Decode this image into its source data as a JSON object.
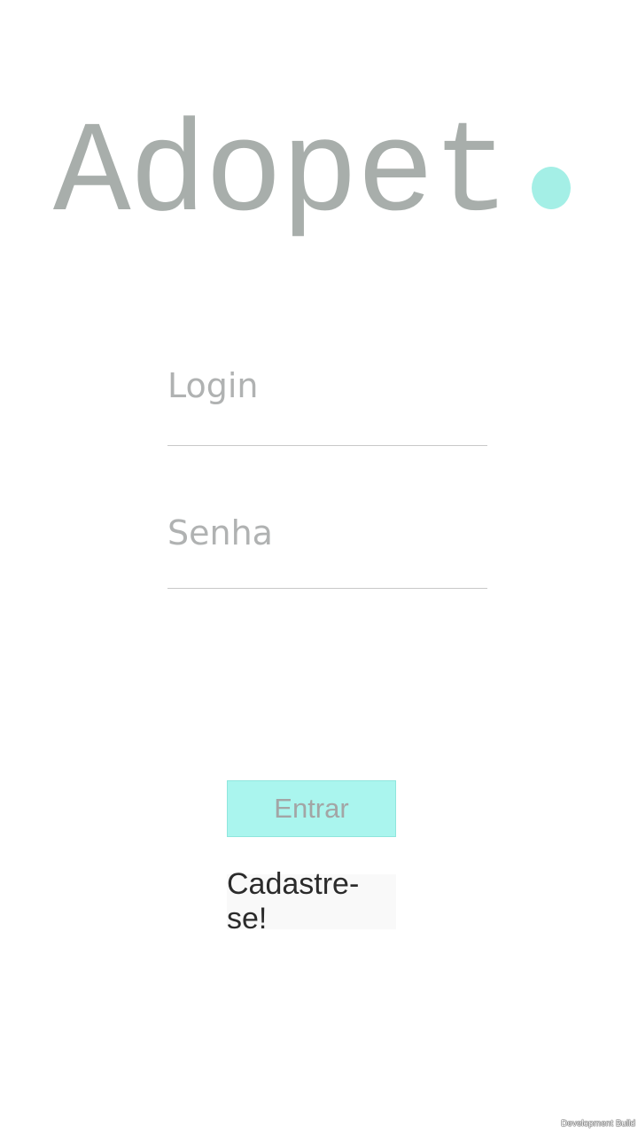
{
  "logo": {
    "text": "Adopet",
    "dot_color": "#a4efe6"
  },
  "form": {
    "login_placeholder": "Login",
    "password_placeholder": "Senha"
  },
  "buttons": {
    "enter_label": "Entrar",
    "signup_label": "Cadastre-se!"
  },
  "footer": {
    "build_label": "Development Build"
  },
  "colors": {
    "accent": "#aaf5ee",
    "logo_text": "#a8aeab"
  }
}
